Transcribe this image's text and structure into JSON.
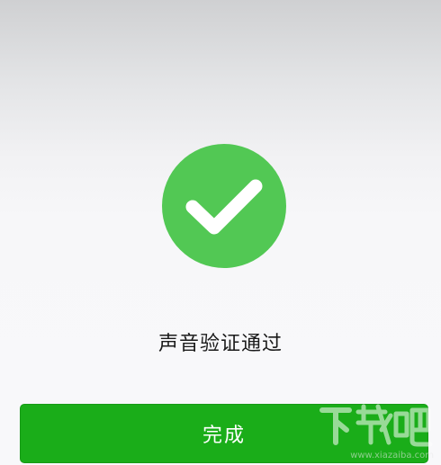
{
  "result": {
    "icon": "checkmark-circle-icon",
    "message": "声音验证通过",
    "icon_color": "#52c854"
  },
  "actions": {
    "done_label": "完成",
    "button_color": "#1aad19"
  },
  "watermark": {
    "brand": "下载吧",
    "url": "www.xiazaiba.com"
  }
}
